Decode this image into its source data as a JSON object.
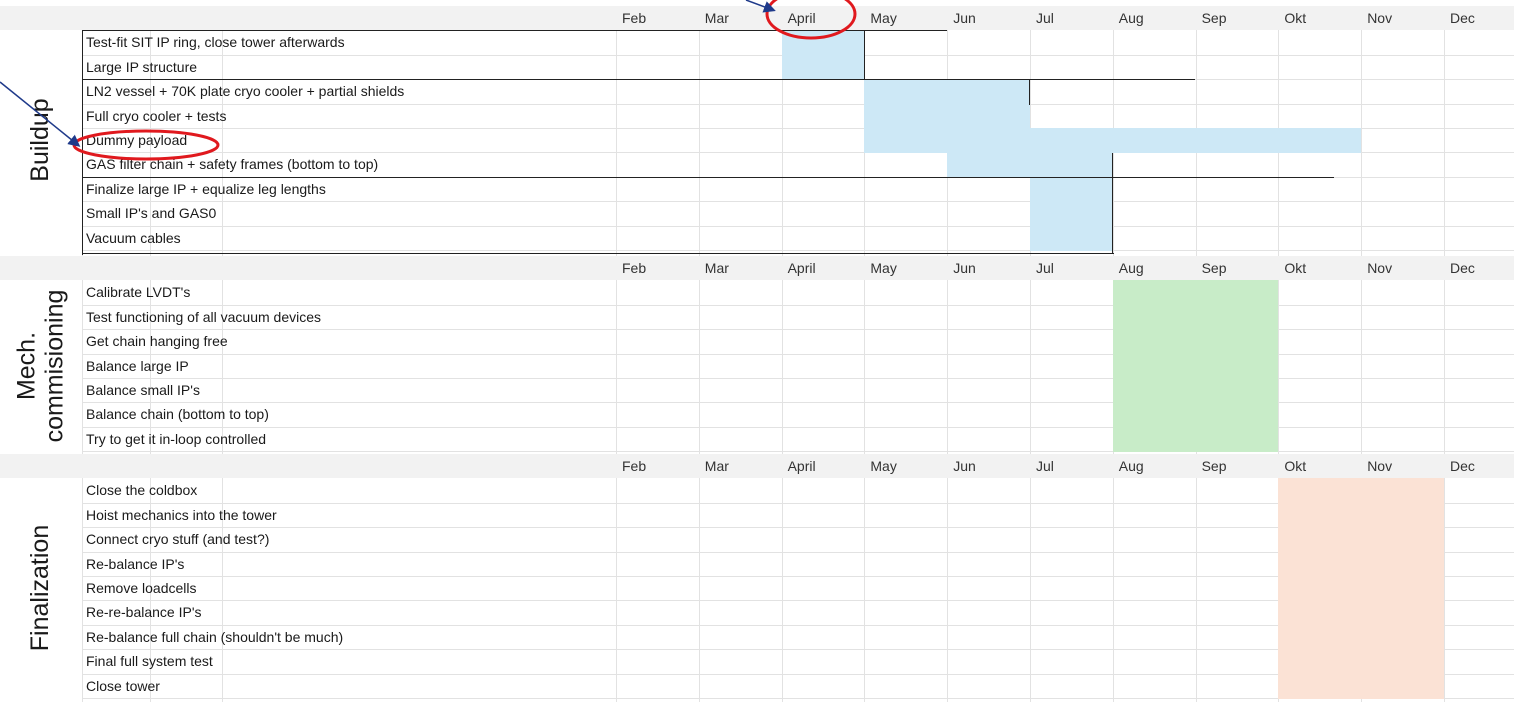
{
  "months": [
    "Feb",
    "Mar",
    "April",
    "May",
    "Jun",
    "Jul",
    "Aug",
    "Sep",
    "Okt",
    "Nov",
    "Dec"
  ],
  "sections": [
    {
      "title_line1": "Buildup",
      "title_line2": "",
      "color": "#cde8f6",
      "tasks": [
        {
          "label": "Test-fit SIT IP ring, close tower afterwards",
          "start": "April",
          "end": "April"
        },
        {
          "label": "Large IP structure",
          "start": "April",
          "end": "April"
        },
        {
          "label": "LN2 vessel + 70K plate cryo cooler + partial shields",
          "start": "May",
          "end": "Jun"
        },
        {
          "label": "Full cryo cooler + tests",
          "start": "May",
          "end": "Jun"
        },
        {
          "label": "Dummy payload",
          "start": "May",
          "end": "Okt"
        },
        {
          "label": "GAS filter chain + safety frames (bottom to top)",
          "start": "Jun",
          "end": "Jul"
        },
        {
          "label": "Finalize large IP + equalize leg lengths",
          "start": "Jul",
          "end": "Jul"
        },
        {
          "label": "Small IP's and GAS0",
          "start": "Jul",
          "end": "Jul"
        },
        {
          "label": "Vacuum cables",
          "start": "Jul",
          "end": "Jul"
        }
      ]
    },
    {
      "title_line1": "Mech.",
      "title_line2": "commisioning",
      "color": "#c8ecc8",
      "tasks": [
        {
          "label": "Calibrate LVDT's",
          "start": "Aug",
          "end": "Sep"
        },
        {
          "label": "Test functioning of all vacuum devices",
          "start": "Aug",
          "end": "Sep"
        },
        {
          "label": "Get chain hanging free",
          "start": "Aug",
          "end": "Sep"
        },
        {
          "label": "Balance large IP",
          "start": "Aug",
          "end": "Sep"
        },
        {
          "label": "Balance small IP's",
          "start": "Aug",
          "end": "Sep"
        },
        {
          "label": "Balance chain (bottom to top)",
          "start": "Aug",
          "end": "Sep"
        },
        {
          "label": "Try to get it in-loop controlled",
          "start": "Aug",
          "end": "Sep"
        }
      ]
    },
    {
      "title_line1": "Finalization",
      "title_line2": "",
      "color": "#fbe2d5",
      "tasks": [
        {
          "label": "Close the coldbox",
          "start": "Okt",
          "end": "Nov"
        },
        {
          "label": "Hoist mechanics into the tower",
          "start": "Okt",
          "end": "Nov"
        },
        {
          "label": "Connect cryo stuff (and test?)",
          "start": "Okt",
          "end": "Nov"
        },
        {
          "label": "Re-balance IP's",
          "start": "Okt",
          "end": "Nov"
        },
        {
          "label": "Remove loadcells",
          "start": "Okt",
          "end": "Nov"
        },
        {
          "label": "Re-re-balance IP's",
          "start": "Okt",
          "end": "Nov"
        },
        {
          "label": "Re-balance full chain (shouldn't be much)",
          "start": "Okt",
          "end": "Nov"
        },
        {
          "label": "Final full system test",
          "start": "Okt",
          "end": "Nov"
        },
        {
          "label": "Close tower",
          "start": "Okt",
          "end": "Nov"
        }
      ]
    }
  ],
  "annotation_color": "#e0191e",
  "arrow_color": "#1f3a8a"
}
